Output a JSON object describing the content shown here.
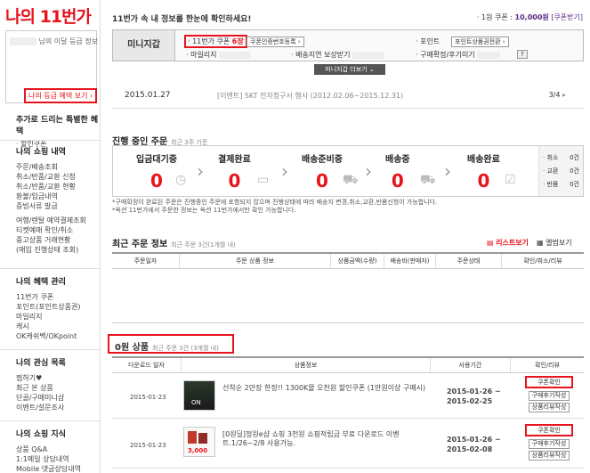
{
  "sidebar": {
    "logo_my": "나의",
    "logo_brand": "11번가",
    "grade_text": "님의 이달 등급 정보",
    "grade_button": "나의 등급 혜택 보기 ›",
    "special_title": "추가로 드리는 특별한 혜택",
    "special_item": "· 할인쿠폰",
    "shopping_title": "나의 쇼핑 내역",
    "shopping_items": [
      "주문/배송조회",
      "취소/반품/교환 신청",
      "취소/반품/교환 현황",
      "환불/입금내역",
      "증빙서류 발급"
    ],
    "shopping_items2": [
      "여행/렌탈 예약결제조회",
      "티켓예매 확인/취소",
      "중고상품 거래현황",
      "(매입 진행상태 조회)"
    ],
    "benefit_title": "나의 혜택 관리",
    "benefit_items": [
      "11번가 쿠폰",
      "포인트(포인트상품권)",
      "마일리지",
      "캐시",
      "OK캐쉬백/OKpoint"
    ],
    "interest_title": "나의 관심 목록",
    "interest_items": [
      "찜하기♥",
      "최근 본 상품",
      "단골/구매미니샵",
      "이벤트/설문조사"
    ],
    "knowledge_title": "나의 쇼핑 지식",
    "knowledge_items": [
      "상품 Q&A",
      "1:1메일 상담내역",
      "Mobile 댓글상담내역"
    ]
  },
  "header": {
    "message": "11번가 속 내 정보를 한눈에 확인하세요!",
    "coupon_prefix": "· 1원 쿠폰 :",
    "coupon_value": "10,000원",
    "coupon_link": "[쿠폰받기]"
  },
  "mini": {
    "title": "미니지갑",
    "coupon_label": "· 11번가 쿠폰",
    "coupon_count": "6장",
    "coupon_btn": "쿠폰인증번호등록 ›",
    "point_label": "· 포인트",
    "point_btn": "포인트상품권전환 ›",
    "mileage_label": "· 마일리지",
    "delay_label": "· 배송지연 보상받기",
    "confirm_label": "· 구매확정/후기미기",
    "help_btn": "?",
    "more_btn": "미니지갑 더보기 ⌄"
  },
  "notice": {
    "date": "2015.01.27",
    "text": "[이벤트] SKT 전자청구서 행사 (2012.02.06~2015.12.31)",
    "page": "3/4"
  },
  "ongoing": {
    "title": "진행 중인 주문",
    "sub": "최근 3주 기준",
    "steps": [
      {
        "label": "입금대기중",
        "count": "0"
      },
      {
        "label": "결제완료",
        "count": "0"
      },
      {
        "label": "배송준비중",
        "count": "0"
      },
      {
        "label": "배송중",
        "count": "0"
      },
      {
        "label": "배송완료",
        "count": "0"
      }
    ],
    "side": [
      {
        "label": "· 취소",
        "count": "0건"
      },
      {
        "label": "· 교환",
        "count": "0건"
      },
      {
        "label": "· 반품",
        "count": "0건"
      }
    ],
    "note1": "*구매확정이 완료된 주문은 진행중인 주문에 포함되지 않으며 진행상태에 따라 배송지 변경,취소,교환,반품신청이 가능합니다.",
    "note2": "*옥션 11번가에서 주문한 정보는 옥션 11번가에서만 확인 가능합니다."
  },
  "recent": {
    "title": "최근 주문 정보",
    "sub": "최근 주문 3건(1개월 내)",
    "legend1": "리스트보기",
    "legend2": "앨범보기",
    "headers": [
      "주문일자",
      "주문 상품 정보",
      "상품금액(수량)",
      "배송비(판매자)",
      "주문상태",
      "확인/취소/리뷰"
    ]
  },
  "zero": {
    "title": "0원 상품",
    "sub": "최근 주문 3건 (3개월 내)",
    "headers": [
      "다운로드 일자",
      "상품정보",
      "사용기간",
      "확인/리뷰"
    ],
    "rows": [
      {
        "date": "2015-01-23",
        "info": "선착순 2만장 한정!! 1300K몰 오천원 할인쿠폰 (1만원이상 구매시)",
        "period_from": "2015-01-26 ~",
        "period_to": "2015-02-25",
        "btn1": "쿠폰확인",
        "btn2": "구매후기작성",
        "btn3": "상품리뷰작성",
        "thumb_text": "ON"
      },
      {
        "date": "2015-01-23",
        "info": "[0원딜]정원e샵 쇼핑 3천원 쇼핑적립금 부료 다운로드 이벤트.1/26~2/8 사용가능.",
        "period_from": "2015-01-26 ~",
        "period_to": "2015-02-08",
        "btn1": "쿠폰확인",
        "btn2": "구매후기작성",
        "btn3": "상품리뷰작성",
        "thumb_text": "3,000"
      }
    ]
  },
  "colors": {
    "accent": "#e8141c",
    "purple": "#5b2a86"
  }
}
